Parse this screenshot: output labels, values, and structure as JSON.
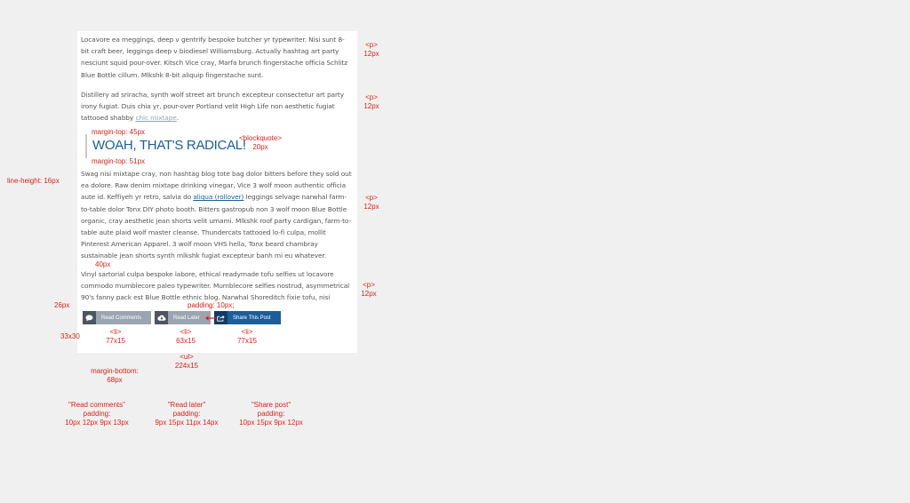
{
  "paragraphs": {
    "p1": "Locavore ea meggings, deep v gentrify bespoke butcher yr typewriter. Nisi sunt 8-bit craft beer, leggings deep v biodiesel Williamsburg. Actually hashtag art party nesciunt squid pour-over. Kitsch Vice cray, Marfa brunch fingerstache officia Schlitz Blue Bottle cillum. Mlkshk 8-bit aliquip fingerstache sunt.",
    "p2_text": "Distillery ad sriracha, synth wolf street art brunch excepteur consectetur art party irony fugiat. Duis chia yr, pour-over Portland velit High Life non aesthetic fugiat tattooed shabby ",
    "p2_link": "chic mixtape",
    "p2_end": ".",
    "p3_start": "Swag nisi mixtape cray, non hashtag blog tote bag dolor bitters before they sold out ea dolore. Raw denim mixtape drinking vinegar, Vice 3 wolf moon authentic officia aute id. Keffiyeh yr retro, salvia do ",
    "p3_link": "aliqua (rollover)",
    "p3_end": " leggings selvage narwhal farm-to-table dolor Tonx DIY photo booth. Bitters gastropub non 3 wolf moon Blue Bottle organic, cray aesthetic jean shorts velit umami. Mlkshk roof party cardigan, farm-to-table aute plaid wolf master cleanse. Thundercats tattooed lo-fi culpa, mollit Pinterest American Apparel. 3 wolf moon VHS hella, Tonx beard chambray sustainable jean shorts synth mlkshk fugiat excepteur banh mi eu whatever.",
    "p4": "Vinyl sartorial culpa bespoke labore, ethical readymade tofu selfies ut locavore commodo mumblecore paleo typewriter. Mumblecore selfies nostrud, asymmetrical 90's fanny pack est Blue Bottle ethnic blog. Narwhal Shoreditch fixie tofu, nisi before"
  },
  "blockquote": "WOAH, THAT'S RADICAL!",
  "buttons": {
    "read": "Read Comments",
    "later": "Read Later",
    "share": "Share This Post"
  },
  "annotations": {
    "p_tag": "<p>",
    "p_size": "12px",
    "mt45": "margin-top: 45px",
    "mt51": "margin-top: 51px",
    "bq_tag": "<blockquote>",
    "bq_size": "20px",
    "line_height": "line-height: 16px",
    "gap40": "40px",
    "padding10": "padding: 10px;",
    "size26": "26px",
    "icon33": "33x30",
    "li_tag": "<li>",
    "li_77": "77x15",
    "li_63": "63x15",
    "ul_tag": "<ul>",
    "ul_size": "224x15",
    "mb_label": "margin-bottom:",
    "mb_val": "68px",
    "rc_title": "\"Read comments\"",
    "rl_title": "\"Read later\"",
    "sp_title": "\"Share post\"",
    "padding_label": "padding:",
    "rc_pad": "10px 12px 9px 13px",
    "rl_pad": "9px 15px 11px 14px",
    "sp_pad": "10px 15px 9px 12px"
  },
  "colors": {
    "annotation": "#d9241b",
    "accent": "#1b5e9a",
    "button_grey": "#9aa5b0"
  },
  "icons": [
    "comment-icon",
    "cloud-download-icon",
    "share-icon"
  ]
}
